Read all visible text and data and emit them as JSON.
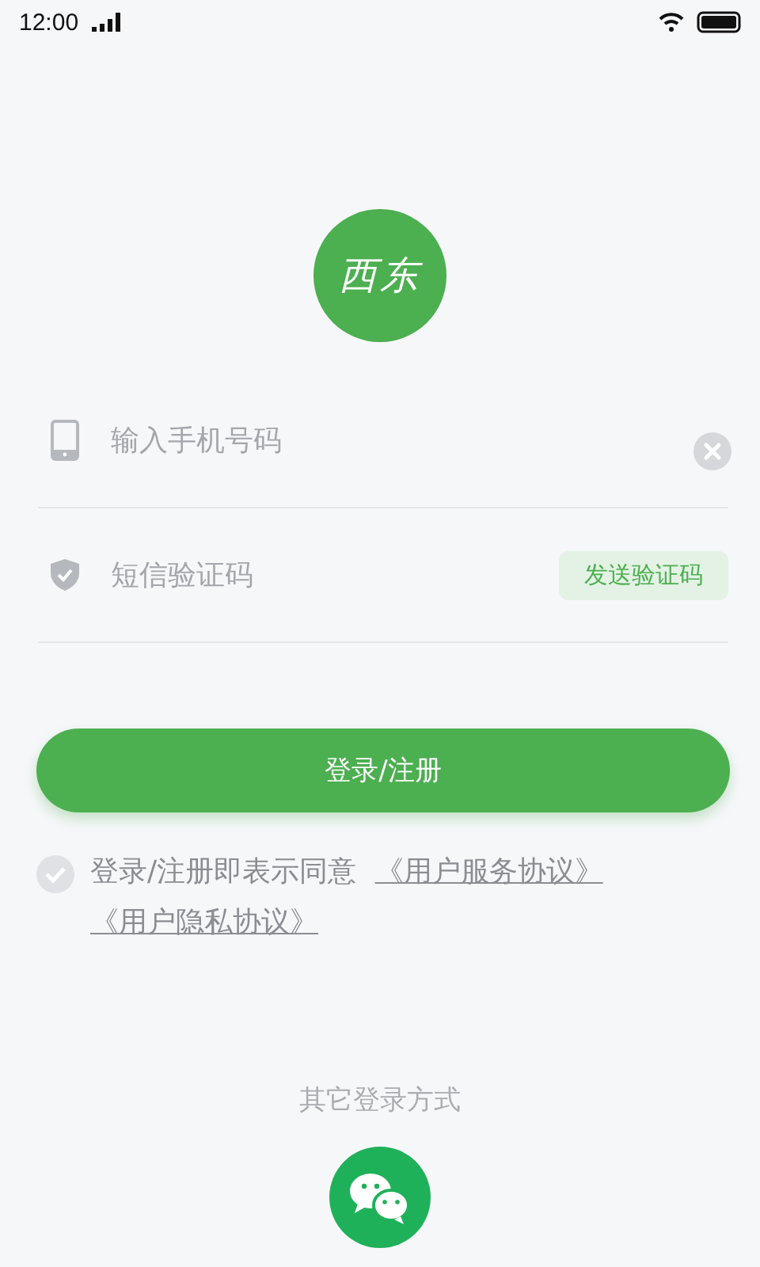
{
  "status_bar": {
    "time": "12:00"
  },
  "logo": {
    "text": "西东"
  },
  "phone_field": {
    "placeholder": "输入手机号码"
  },
  "code_field": {
    "placeholder": "短信验证码",
    "send_button": "发送验证码"
  },
  "login_button": "登录/注册",
  "agreement": {
    "checked": false,
    "text": "登录/注册即表示同意",
    "links": [
      "《用户服务协议》",
      "《用户隐私协议》"
    ]
  },
  "other_login": {
    "label": "其它登录方式"
  }
}
